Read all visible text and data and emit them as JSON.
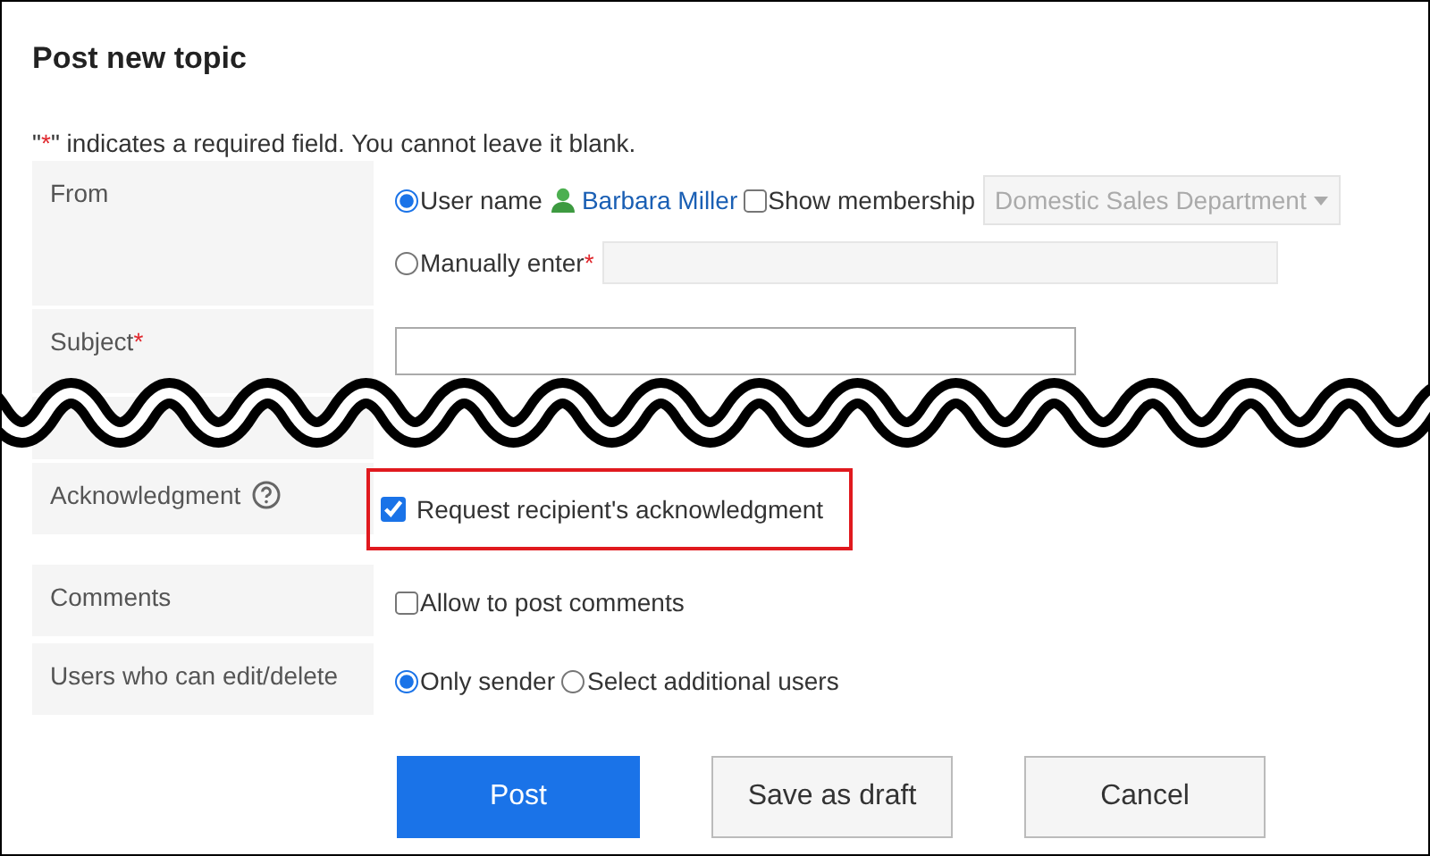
{
  "title": "Post new topic",
  "note": {
    "before": "\"",
    "mark": "*",
    "after": "\" indicates a required field. You cannot leave it blank."
  },
  "rows": [
    {
      "kind": "from",
      "label": "From",
      "user_option": {
        "label": "User name",
        "selected": true,
        "user": "Barbara Miller",
        "membership": {
          "label": "Show membership",
          "checked": false
        },
        "dropdown": "Domestic Sales Department"
      },
      "manual_option": {
        "label": "Manually enter",
        "required_mark": "*",
        "selected": false
      }
    },
    {
      "kind": "text",
      "label": "Subject",
      "required_mark": "*"
    },
    {
      "kind": "cut"
    },
    {
      "kind": "checkbox",
      "label": "Acknowledgment",
      "help": true,
      "option": "Request recipient's acknowledgment",
      "checked": true,
      "highlighted": true
    },
    {
      "kind": "checkbox",
      "label": "Comments",
      "help": false,
      "option": "Allow to post comments",
      "checked": false,
      "highlighted": false
    },
    {
      "kind": "radio",
      "label": "Users who can edit/delete",
      "options": [
        {
          "label": "Only sender",
          "selected": true
        },
        {
          "label": "Select additional users",
          "selected": false
        }
      ]
    }
  ],
  "buttons": [
    {
      "label": "Post",
      "kind": "primary"
    },
    {
      "label": "Save as draft",
      "kind": "secondary"
    },
    {
      "label": "Cancel",
      "kind": "secondary"
    }
  ]
}
